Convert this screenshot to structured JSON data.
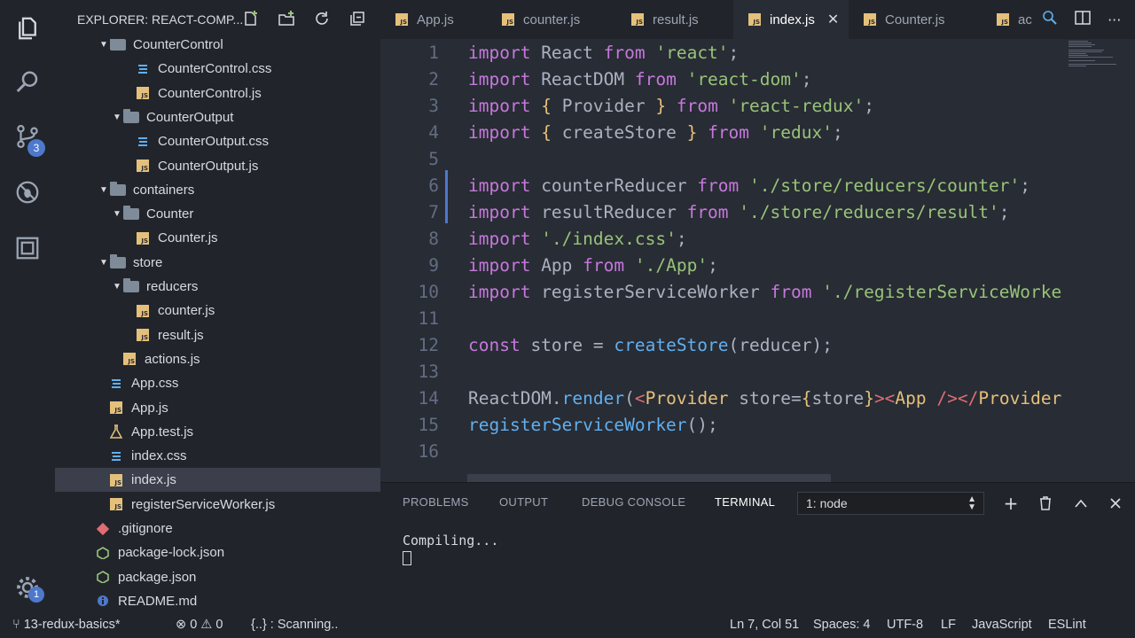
{
  "sidebar": {
    "title": "EXPLORER: REACT-COMP...",
    "items": [
      {
        "label": "CounterControl",
        "type": "folder",
        "indent": 1,
        "clipped": true
      },
      {
        "label": "CounterControl.css",
        "type": "css",
        "indent": 3
      },
      {
        "label": "CounterControl.js",
        "type": "js",
        "indent": 3
      },
      {
        "label": "CounterOutput",
        "type": "folder",
        "indent": 2,
        "open": true
      },
      {
        "label": "CounterOutput.css",
        "type": "css",
        "indent": 3
      },
      {
        "label": "CounterOutput.js",
        "type": "js",
        "indent": 3
      },
      {
        "label": "containers",
        "type": "folder",
        "indent": 1,
        "open": true
      },
      {
        "label": "Counter",
        "type": "folder",
        "indent": 2,
        "open": true
      },
      {
        "label": "Counter.js",
        "type": "js",
        "indent": 3
      },
      {
        "label": "store",
        "type": "folder",
        "indent": 1,
        "open": true
      },
      {
        "label": "reducers",
        "type": "folder",
        "indent": 2,
        "open": true
      },
      {
        "label": "counter.js",
        "type": "js",
        "indent": 3
      },
      {
        "label": "result.js",
        "type": "js",
        "indent": 3
      },
      {
        "label": "actions.js",
        "type": "js",
        "indent": 2
      },
      {
        "label": "App.css",
        "type": "css",
        "indent": 1
      },
      {
        "label": "App.js",
        "type": "js",
        "indent": 1
      },
      {
        "label": "App.test.js",
        "type": "test",
        "indent": 1
      },
      {
        "label": "index.css",
        "type": "css",
        "indent": 1
      },
      {
        "label": "index.js",
        "type": "js",
        "indent": 1,
        "selected": true
      },
      {
        "label": "registerServiceWorker.js",
        "type": "js",
        "indent": 1
      },
      {
        "label": ".gitignore",
        "type": "git",
        "indent": 0
      },
      {
        "label": "package-lock.json",
        "type": "npm",
        "indent": 0
      },
      {
        "label": "package.json",
        "type": "npm",
        "indent": 0
      },
      {
        "label": "README.md",
        "type": "info",
        "indent": 0
      }
    ]
  },
  "activity": {
    "scm_badge": "3",
    "settings_badge": "1"
  },
  "tabs": [
    {
      "label": "App.js"
    },
    {
      "label": "counter.js"
    },
    {
      "label": "result.js"
    },
    {
      "label": "index.js",
      "active": true
    },
    {
      "label": "Counter.js"
    },
    {
      "label": "ac"
    }
  ],
  "editor": {
    "line_numbers": [
      "1",
      "2",
      "3",
      "4",
      "5",
      "6",
      "7",
      "8",
      "9",
      "10",
      "11",
      "12",
      "13",
      "14",
      "15",
      "16"
    ]
  },
  "panel": {
    "tabs": [
      "PROBLEMS",
      "OUTPUT",
      "DEBUG CONSOLE",
      "TERMINAL"
    ],
    "active_tab": "TERMINAL",
    "terminal_select": "1: node",
    "terminal_output": "Compiling..."
  },
  "status": {
    "branch": "13-redux-basics*",
    "errors": "0",
    "warnings": "0",
    "scanning": "{..} : Scanning..",
    "position": "Ln 7, Col 51",
    "spaces": "Spaces: 4",
    "encoding": "UTF-8",
    "eol": "LF",
    "language": "JavaScript",
    "linter": "ESLint"
  },
  "colors": {
    "accent": "#4d78cc",
    "keyword": "#c678dd",
    "string": "#98c379",
    "function": "#61afef",
    "tag": "#e06c75",
    "js_icon": "#e5c07b"
  }
}
